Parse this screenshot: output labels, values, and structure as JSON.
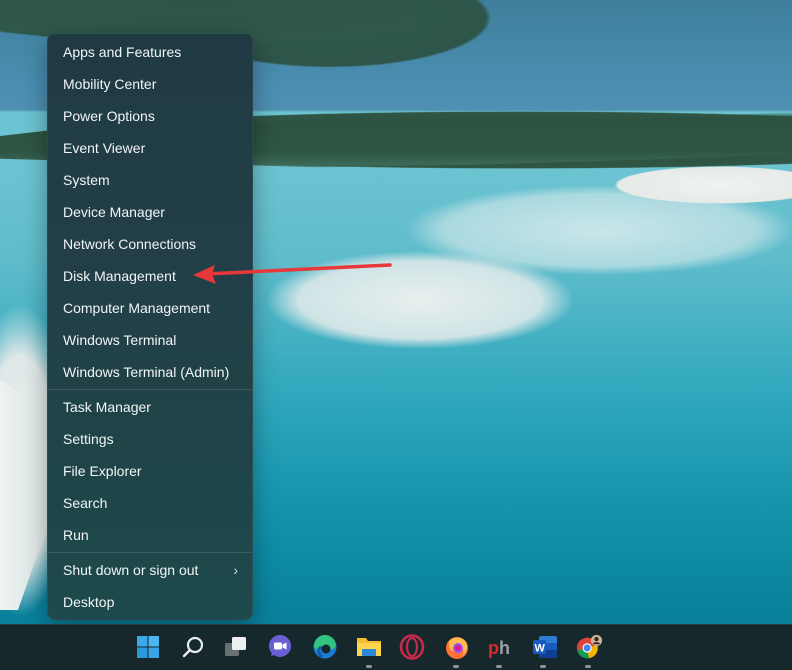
{
  "menu": {
    "items": [
      {
        "label": "Apps and Features"
      },
      {
        "label": "Mobility Center"
      },
      {
        "label": "Power Options"
      },
      {
        "label": "Event Viewer"
      },
      {
        "label": "System"
      },
      {
        "label": "Device Manager"
      },
      {
        "label": "Network Connections"
      },
      {
        "label": "Disk Management",
        "highlighted_by_arrow": true
      },
      {
        "label": "Computer Management"
      },
      {
        "label": "Windows Terminal"
      },
      {
        "label": "Windows Terminal (Admin)"
      },
      {
        "label": "Task Manager"
      },
      {
        "label": "Settings"
      },
      {
        "label": "File Explorer"
      },
      {
        "label": "Search"
      },
      {
        "label": "Run"
      },
      {
        "label": "Shut down or sign out",
        "has_submenu": true,
        "submenu_glyph": "›"
      },
      {
        "label": "Desktop"
      }
    ]
  },
  "annotation": {
    "type": "arrow",
    "color": "#e8383a",
    "points_to": "Disk Management"
  },
  "taskbar": {
    "icons": [
      {
        "name": "start",
        "running": false
      },
      {
        "name": "search",
        "running": false
      },
      {
        "name": "task-view",
        "running": false
      },
      {
        "name": "teams-chat",
        "running": false
      },
      {
        "name": "edge",
        "running": false
      },
      {
        "name": "file-explorer",
        "running": true
      },
      {
        "name": "opera",
        "running": false
      },
      {
        "name": "firefox",
        "running": true
      },
      {
        "name": "ph-app",
        "running": true
      },
      {
        "name": "word",
        "running": true
      },
      {
        "name": "chrome",
        "running": true
      }
    ],
    "word_letter": "W",
    "ph_letters": "ph"
  },
  "colors": {
    "menu_bg": "#1f3a43",
    "taskbar_bg": "#17282c",
    "arrow": "#e8383a",
    "start_blue": "#38a8e8"
  }
}
